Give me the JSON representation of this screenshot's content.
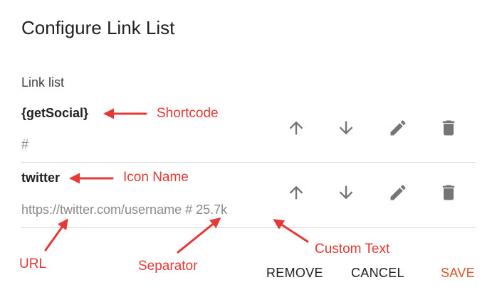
{
  "dialog": {
    "title": "Configure Link List",
    "section_label": "Link list"
  },
  "items": [
    {
      "name": "{getSocial}",
      "url": "#"
    },
    {
      "name": "twitter",
      "url": "https://twitter.com/username # 25.7k"
    }
  ],
  "item_actions": [
    "arrow-up-icon",
    "arrow-down-icon",
    "pencil-icon",
    "trash-icon"
  ],
  "footer": {
    "remove_label": "REMOVE",
    "cancel_label": "CANCEL",
    "save_label": "SAVE"
  },
  "annotations": {
    "shortcode": "Shortcode",
    "icon_name": "Icon Name",
    "url": "URL",
    "separator": "Separator",
    "custom_text": "Custom Text"
  },
  "colors": {
    "annotation": "#e53935",
    "save": "#e0542b",
    "icon": "#757575"
  }
}
